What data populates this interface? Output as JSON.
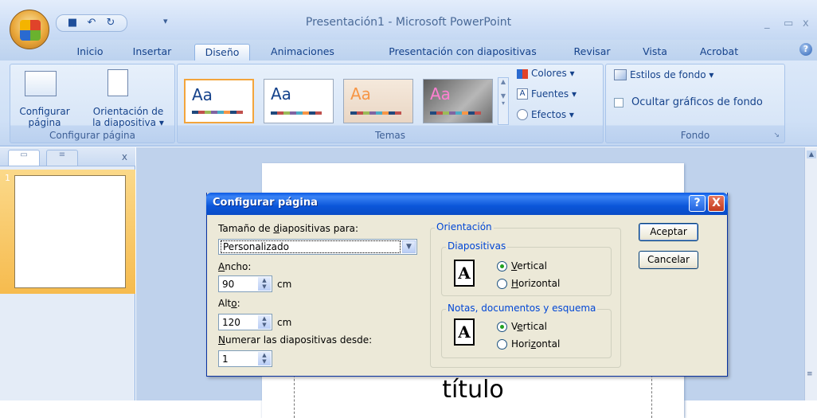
{
  "app": {
    "title": "Presentación1 - Microsoft PowerPoint",
    "minimize": "_",
    "maximize": "▭",
    "close": "x"
  },
  "tabs": [
    "Inicio",
    "Insertar",
    "Diseño",
    "Animaciones",
    "Presentación con diapositivas",
    "Revisar",
    "Vista",
    "Acrobat"
  ],
  "ribbon": {
    "configurar_pagina": {
      "btn1_line1": "Configurar",
      "btn1_line2": "página",
      "btn2_line1": "Orientación de",
      "btn2_line2": "la diapositiva ▾",
      "label": "Configurar página"
    },
    "temas": {
      "label": "Temas",
      "theme_text": "Aa",
      "colores": "Colores ▾",
      "fuentes": "Fuentes ▾",
      "efectos": "Efectos ▾"
    },
    "fondo": {
      "estilos": "Estilos de fondo ▾",
      "ocultar": "Ocultar gráficos de fondo",
      "label": "Fondo"
    }
  },
  "left_panel": {
    "close": "x",
    "slide_number": "1"
  },
  "slide": {
    "title_text": "título"
  },
  "dialog": {
    "title": "Configurar página",
    "help": "?",
    "close": "X",
    "size_label_pre": "Tamaño de ",
    "size_label_u": "d",
    "size_label_post": "iapositivas para:",
    "size_value": "Personalizado",
    "ancho_u": "A",
    "ancho_post": "ncho:",
    "ancho_value": "90",
    "ancho_unit": "cm",
    "alto_pre": "Alt",
    "alto_u": "o",
    "alto_post": ":",
    "alto_value": "120",
    "alto_unit": "cm",
    "numerar_u": "N",
    "numerar_post": "umerar las diapositivas desde:",
    "numerar_value": "1",
    "orientacion_legend": "Orientación",
    "diapositivas_legend": "Diapositivas",
    "notas_legend": "Notas, documentos y esquema",
    "vertical_u": "V",
    "vertical_post": "ertical",
    "horizontal_u": "H",
    "horizontal_post": "orizontal",
    "vertical2_u": "e",
    "vertical2_post": "rtical",
    "horizontal2_pre": "Hori",
    "horizontal2_u": "z",
    "horizontal2_post": "ontal",
    "page_glyph": "A",
    "aceptar": "Aceptar",
    "cancelar": "Cancelar"
  }
}
